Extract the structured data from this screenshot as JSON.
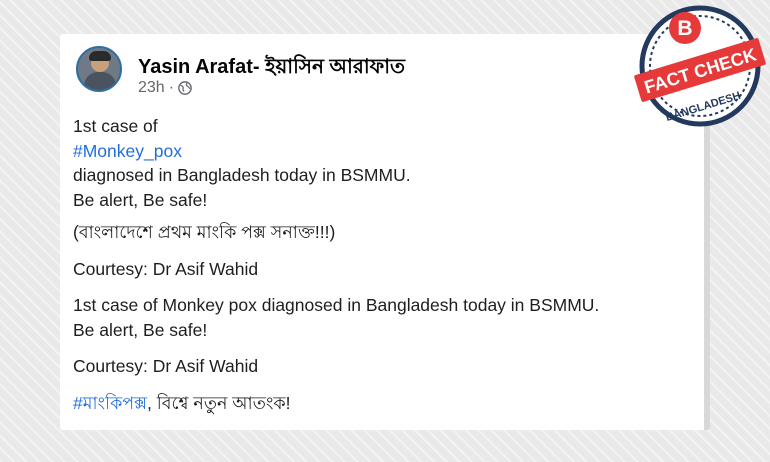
{
  "post": {
    "author": "Yasin Arafat- ইয়াসিন আরাফাত",
    "time": "23h",
    "privacy_icon": "globe-icon",
    "lines": {
      "l1": "1st case of",
      "l2_hashtag": "#Monkey_pox",
      "l3": "diagnosed in Bangladesh   today in BSMMU.",
      "l4": "Be alert, Be safe!",
      "l5": "(বাংলাদেশে প্রথম মাংকি পক্স সনাক্ত!!!)",
      "l6": "Courtesy: Dr Asif Wahid",
      "l7": "1st case of Monkey pox diagnosed in Bangladesh   today in BSMMU.",
      "l8": "Be alert, Be safe!",
      "l9": "Courtesy: Dr Asif Wahid",
      "l10_hashtag": "#মাংকিপক্স",
      "l10_rest": ", বিশ্বে নতুন আতংক!"
    }
  },
  "badge": {
    "letter": "B",
    "text": "FACT CHECK",
    "country": "BANGLADESH",
    "colors": {
      "red": "#e63a3a",
      "navy": "#23395e"
    }
  },
  "colors": {
    "hashtag": "#216fdb",
    "text": "#1c1e21",
    "meta": "#65676b"
  }
}
